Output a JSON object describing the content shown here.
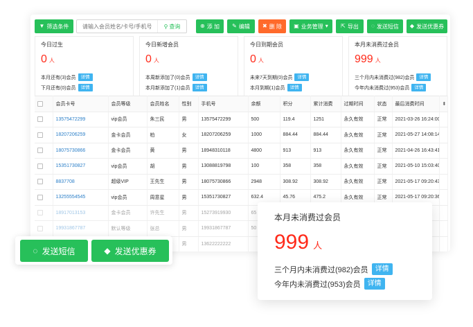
{
  "toolbar": {
    "filter_label": "筛选条件",
    "search_placeholder": "请输入会员姓名/卡号/手机号",
    "search_label": "查询",
    "add_label": "添 加",
    "edit_label": "编辑",
    "delete_label": "删 除",
    "business_label": "业务管理",
    "export_label": "导出",
    "sms_label": "发送短信",
    "coupon_label": "发送优惠券"
  },
  "stats": [
    {
      "title": "今日过生",
      "value": "0",
      "unit": "人",
      "lines": [
        {
          "text": "本月还有(3)会员",
          "tag": "详情"
        },
        {
          "text": "下月还有(0)会员",
          "tag": "详情"
        }
      ]
    },
    {
      "title": "今日新增会员",
      "value": "0",
      "unit": "人",
      "lines": [
        {
          "text": "本周新添加了(0)会员",
          "tag": "详情"
        },
        {
          "text": "本月新添加了(1)会员",
          "tag": "详情"
        }
      ]
    },
    {
      "title": "今日到期会员",
      "value": "0",
      "unit": "人",
      "lines": [
        {
          "text": "未来7天到期(0)会员",
          "tag": "详情"
        },
        {
          "text": "本月到期(1)会员",
          "tag": "详情"
        }
      ]
    },
    {
      "title": "本月未消费过会员",
      "value": "999",
      "unit": "人",
      "lines": [
        {
          "text": "三个月内未消费过(982)会员",
          "tag": "详情"
        },
        {
          "text": "今年内未消费过(953)会员",
          "tag": "详情"
        }
      ]
    }
  ],
  "table": {
    "columns": [
      "会员卡号",
      "会员等级",
      "会员姓名",
      "性别",
      "手机号",
      "余额",
      "积分",
      "累计消费",
      "过期时间",
      "状态",
      "最后消费时间"
    ],
    "rows": [
      [
        "13575472299",
        "vip会员",
        "朱三民",
        "男",
        "13575472299",
        "500",
        "119.4",
        "1251",
        "永久有效",
        "正常",
        "2021-03-26 16:24:00"
      ],
      [
        "18207206259",
        "金卡会员",
        "柏",
        "女",
        "18207206259",
        "1000",
        "884.44",
        "884.44",
        "永久有效",
        "正常",
        "2021-05-27 14:08:14"
      ],
      [
        "18075730866",
        "金卡会员",
        "黄",
        "男",
        "18948310118",
        "4800",
        "913",
        "913",
        "永久有效",
        "正常",
        "2021-04-26 16:43:41"
      ],
      [
        "15351730827",
        "vip会员",
        "胡",
        "男",
        "13088819798",
        "100",
        "358",
        "358",
        "永久有效",
        "正常",
        "2021-05-10 15:03:40"
      ],
      [
        "8837708",
        "超级VIP",
        "王先生",
        "男",
        "18075730866",
        "2948",
        "308.92",
        "308.92",
        "永久有效",
        "正常",
        "2021-05-17 09:20:43"
      ],
      [
        "13255554545",
        "vip会员",
        "周意星",
        "男",
        "15351730827",
        "632.4",
        "45.76",
        "475.2",
        "永久有效",
        "正常",
        "2021-05-17 09:20:36"
      ],
      [
        "18917013153",
        "金卡会员",
        "许先生",
        "男",
        "15273919930",
        "65",
        "",
        "",
        "",
        "",
        "1:39:09"
      ],
      [
        "19931867787",
        "默认等级",
        "张总",
        "男",
        "19931867787",
        "50",
        "",
        "",
        "",
        "",
        "16:58"
      ],
      [
        "13622222222",
        "vip会员",
        "江",
        "男",
        "13622222222",
        "",
        "",
        "",
        "",
        "",
        "7:04"
      ],
      [
        "",
        "",
        "",
        "",
        "",
        "",
        "",
        "",
        "",
        "",
        ""
      ]
    ]
  },
  "float_actions": {
    "sms_label": "发送短信",
    "coupon_label": "发送优惠券"
  },
  "float_card": {
    "title": "本月未消费过会员",
    "value": "999",
    "unit": "人",
    "line1": "三个月内未消费过(982)会员",
    "line2": "今年内未消费过(953)会员",
    "tag": "详情"
  },
  "colors": {
    "green": "#27c05a",
    "orange": "#ff6a2b",
    "red": "#ff2a1a",
    "blue_tag": "#3fb4f0",
    "link": "#2b7fc8"
  },
  "icons": {
    "filter": "filter-icon",
    "search": "search-icon",
    "add": "plus-circle-icon",
    "edit": "edit-icon",
    "delete": "trash-icon",
    "business": "briefcase-icon",
    "export": "export-icon",
    "sms": "chat-bubble-icon",
    "coupon": "tag-icon"
  }
}
